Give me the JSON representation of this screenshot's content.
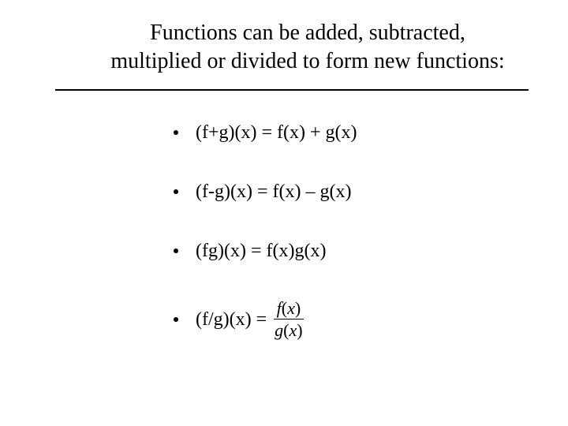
{
  "title_line1": "Functions can be added, subtracted,",
  "title_line2": "multiplied or divided to form new functions:",
  "items": [
    {
      "text": "(f+g)(x) = f(x) + g(x)"
    },
    {
      "text": "(f-g)(x) = f(x) – g(x)"
    },
    {
      "text": "(fg)(x) = f(x)g(x)"
    }
  ],
  "last_item": {
    "prefix": " (f/g)(x) = ",
    "frac_num_f": "f",
    "frac_num_x": "x",
    "frac_den_g": "g",
    "frac_den_x": "x",
    "lp": "(",
    "rp": ")"
  }
}
